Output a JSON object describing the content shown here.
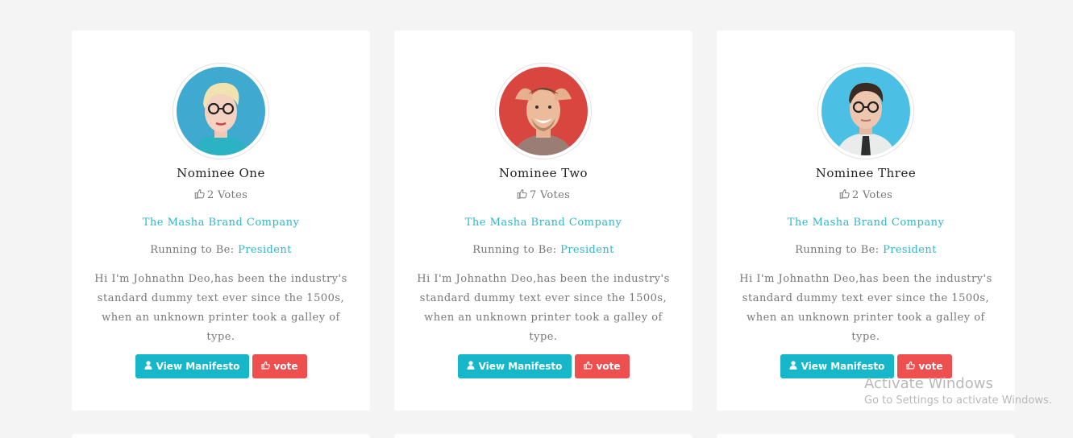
{
  "nominees": [
    {
      "name": "Nominee One",
      "votes": "2 Votes",
      "company": "The Masha Brand Company",
      "running_label": "Running to Be:",
      "role": "President",
      "bio": "Hi I'm Johnathn Deo,has been the industry's standard dummy text ever since the 1500s, when an unknown printer took a galley of type.",
      "manifesto_label": "View Manifesto",
      "vote_label": "vote",
      "avatar_bg": "#3fa9cf"
    },
    {
      "name": "Nominee Two",
      "votes": "7 Votes",
      "company": "The Masha Brand Company",
      "running_label": "Running to Be:",
      "role": "President",
      "bio": "Hi I'm Johnathn Deo,has been the industry's standard dummy text ever since the 1500s, when an unknown printer took a galley of type.",
      "manifesto_label": "View Manifesto",
      "vote_label": "vote",
      "avatar_bg": "#d9463f"
    },
    {
      "name": "Nominee Three",
      "votes": "2 Votes",
      "company": "The Masha Brand Company",
      "running_label": "Running to Be:",
      "role": "President",
      "bio": "Hi I'm Johnathn Deo,has been the industry's standard dummy text ever since the 1500s, when an unknown printer took a galley of type.",
      "manifesto_label": "View Manifesto",
      "vote_label": "vote",
      "avatar_bg": "#4cc0e4"
    }
  ],
  "icons": {
    "votes": "thumbs-up-outline-icon",
    "manifesto": "user-icon",
    "vote": "thumbs-up-icon"
  },
  "colors": {
    "accent": "#17b6c9",
    "vote_button": "#ee4f4f",
    "link_text": "#2fb6c9",
    "background": "#f4f4f4"
  },
  "watermark": {
    "title": "Activate Windows",
    "subtitle": "Go to Settings to activate Windows."
  }
}
